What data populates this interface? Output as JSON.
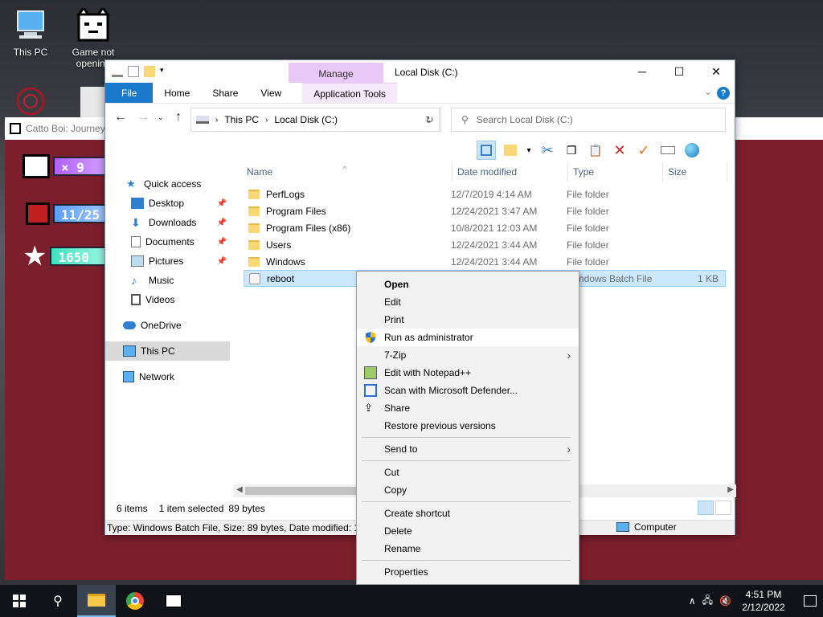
{
  "desktop": {
    "icons": [
      {
        "label": "This PC"
      },
      {
        "label": "Game not opening"
      }
    ]
  },
  "game_window": {
    "title": "Catto Boi: Journey",
    "stats": [
      "× 9",
      "11/25",
      "1650"
    ]
  },
  "explorer": {
    "title": "Local Disk (C:)",
    "manage_tab": "Manage",
    "ribbon_tabs": [
      "File",
      "Home",
      "Share",
      "View",
      "Application Tools"
    ],
    "help": "?",
    "address": {
      "parts": [
        "This PC",
        "Local Disk (C:)"
      ]
    },
    "search": {
      "placeholder": "Search Local Disk (C:)"
    },
    "nav": {
      "quick_access": "Quick access",
      "items": [
        "Desktop",
        "Downloads",
        "Documents",
        "Pictures",
        "Music",
        "Videos"
      ],
      "onedrive": "OneDrive",
      "this_pc": "This PC",
      "network": "Network"
    },
    "columns": {
      "name": "Name",
      "date": "Date modified",
      "type": "Type",
      "size": "Size"
    },
    "files": [
      {
        "name": "PerfLogs",
        "date": "12/7/2019 4:14 AM",
        "type": "File folder",
        "size": ""
      },
      {
        "name": "Program Files",
        "date": "12/24/2021 3:47 AM",
        "type": "File folder",
        "size": ""
      },
      {
        "name": "Program Files (x86)",
        "date": "10/8/2021 12:03 AM",
        "type": "File folder",
        "size": ""
      },
      {
        "name": "Users",
        "date": "12/24/2021 3:44 AM",
        "type": "File folder",
        "size": ""
      },
      {
        "name": "Windows",
        "date": "12/24/2021 3:44 AM",
        "type": "File folder",
        "size": ""
      },
      {
        "name": "reboot",
        "date": "",
        "type": "Windows Batch File",
        "size": "1 KB"
      }
    ],
    "status": {
      "items": "6 items",
      "selected": "1 item selected",
      "bytes": "89 bytes"
    },
    "details": "Type: Windows Batch File, Size: 89 bytes, Date modified: 12/",
    "computer": "Computer"
  },
  "context_menu": {
    "group1": [
      "Open",
      "Edit",
      "Print",
      "Run as administrator",
      "7-Zip",
      "Edit with Notepad++",
      "Scan with Microsoft Defender...",
      "Share",
      "Restore previous versions"
    ],
    "group2": [
      "Send to"
    ],
    "group3": [
      "Cut",
      "Copy"
    ],
    "group4": [
      "Create shortcut",
      "Delete",
      "Rename"
    ],
    "group5": [
      "Properties"
    ]
  },
  "taskbar": {
    "time": "4:51 PM",
    "date": "2/12/2022"
  },
  "colors": {
    "accent": "#1979ca",
    "selection": "#cce8ff",
    "game_bg": "#7c1f2c"
  }
}
